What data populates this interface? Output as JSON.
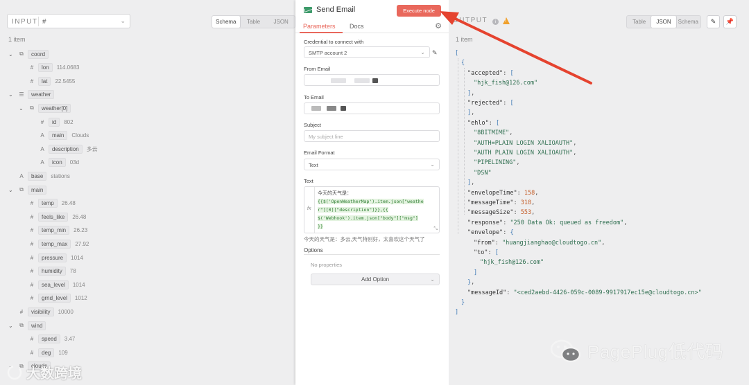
{
  "input_panel": {
    "label": "INPUT",
    "selected": "#",
    "view_tabs": [
      "Schema",
      "Table",
      "JSON"
    ],
    "active_view": "Schema",
    "item_count": "1 item",
    "tree": [
      {
        "key": "coord",
        "type": "object",
        "depth": 0,
        "expanded": true
      },
      {
        "key": "lon",
        "type": "number",
        "value": "114.0683",
        "depth": 1
      },
      {
        "key": "lat",
        "type": "number",
        "value": "22.5455",
        "depth": 1
      },
      {
        "key": "weather",
        "type": "array",
        "depth": 0,
        "expanded": true
      },
      {
        "key": "weather[0]",
        "type": "object",
        "depth": 1,
        "expanded": true
      },
      {
        "key": "id",
        "type": "number",
        "value": "802",
        "depth": 2
      },
      {
        "key": "main",
        "type": "string",
        "value": "Clouds",
        "depth": 2
      },
      {
        "key": "description",
        "type": "string",
        "value": "多云",
        "depth": 2
      },
      {
        "key": "icon",
        "type": "string",
        "value": "03d",
        "depth": 2
      },
      {
        "key": "base",
        "type": "string",
        "value": "stations",
        "depth": 0
      },
      {
        "key": "main",
        "type": "object",
        "depth": 0,
        "expanded": true
      },
      {
        "key": "temp",
        "type": "number",
        "value": "26.48",
        "depth": 1
      },
      {
        "key": "feels_like",
        "type": "number",
        "value": "26.48",
        "depth": 1
      },
      {
        "key": "temp_min",
        "type": "number",
        "value": "26.23",
        "depth": 1
      },
      {
        "key": "temp_max",
        "type": "number",
        "value": "27.92",
        "depth": 1
      },
      {
        "key": "pressure",
        "type": "number",
        "value": "1014",
        "depth": 1
      },
      {
        "key": "humidity",
        "type": "number",
        "value": "78",
        "depth": 1
      },
      {
        "key": "sea_level",
        "type": "number",
        "value": "1014",
        "depth": 1
      },
      {
        "key": "grnd_level",
        "type": "number",
        "value": "1012",
        "depth": 1
      },
      {
        "key": "visibility",
        "type": "number",
        "value": "10000",
        "depth": 0
      },
      {
        "key": "wind",
        "type": "object",
        "depth": 0,
        "expanded": true
      },
      {
        "key": "speed",
        "type": "number",
        "value": "3.47",
        "depth": 1
      },
      {
        "key": "deg",
        "type": "number",
        "value": "109",
        "depth": 1
      },
      {
        "key": "clouds",
        "type": "object",
        "depth": 0,
        "expanded": true
      }
    ]
  },
  "node": {
    "title": "Send Email",
    "execute_label": "Execute node",
    "tabs": [
      "Parameters",
      "Docs"
    ],
    "active_tab": "Parameters",
    "credential_label": "Credential to connect with",
    "credential_value": "SMTP account 2",
    "from_label": "From Email",
    "to_label": "To Email",
    "subject_label": "Subject",
    "subject_placeholder": "My subject line",
    "format_label": "Email Format",
    "format_value": "Text",
    "text_label": "Text",
    "text_lines": [
      "今天的天气是：",
      "{{$('OpenWeatherMap').item.json[\"weathe",
      "r\"][0][\"description\"]}},{{",
      "$('Webhook').item.json[\"body\"][\"msg\"]",
      "}}"
    ],
    "text_result": "今天的天气是：多云,天气特别好，太喜欢这个天气了",
    "options_label": "Options",
    "no_properties": "No properties",
    "add_option": "Add Option"
  },
  "output_panel": {
    "label": "OUTPUT",
    "view_tabs": [
      "Table",
      "JSON",
      "Schema"
    ],
    "active_view": "JSON",
    "item_count": "1 item",
    "json_lines": [
      {
        "indent": 0,
        "parts": [
          [
            "jbr",
            "["
          ]
        ]
      },
      {
        "indent": 1,
        "parts": [
          [
            "jbr",
            "{"
          ]
        ]
      },
      {
        "indent": 2,
        "parts": [
          [
            "jk",
            "\"accepted\""
          ],
          [
            "jp",
            ": "
          ],
          [
            "jbr",
            "["
          ]
        ]
      },
      {
        "indent": 3,
        "parts": [
          [
            "js",
            "\"hjk_fish@126.com\""
          ]
        ]
      },
      {
        "indent": 2,
        "parts": [
          [
            "jbr",
            "]"
          ],
          [
            "jp",
            ","
          ]
        ]
      },
      {
        "indent": 2,
        "parts": [
          [
            "jk",
            "\"rejected\""
          ],
          [
            "jp",
            ": "
          ],
          [
            "jbr",
            "["
          ]
        ]
      },
      {
        "indent": 2,
        "parts": [
          [
            "jbr",
            "]"
          ],
          [
            "jp",
            ","
          ]
        ]
      },
      {
        "indent": 2,
        "parts": [
          [
            "jk",
            "\"ehlo\""
          ],
          [
            "jp",
            ": "
          ],
          [
            "jbr",
            "["
          ]
        ]
      },
      {
        "indent": 3,
        "parts": [
          [
            "js",
            "\"8BITMIME\""
          ],
          [
            "jp",
            ","
          ]
        ]
      },
      {
        "indent": 3,
        "parts": [
          [
            "js",
            "\"AUTH=PLAIN LOGIN XALIOAUTH\""
          ],
          [
            "jp",
            ","
          ]
        ]
      },
      {
        "indent": 3,
        "parts": [
          [
            "js",
            "\"AUTH PLAIN LOGIN XALIOAUTH\""
          ],
          [
            "jp",
            ","
          ]
        ]
      },
      {
        "indent": 3,
        "parts": [
          [
            "js",
            "\"PIPELINING\""
          ],
          [
            "jp",
            ","
          ]
        ]
      },
      {
        "indent": 3,
        "parts": [
          [
            "js",
            "\"DSN\""
          ]
        ]
      },
      {
        "indent": 2,
        "parts": [
          [
            "jbr",
            "]"
          ],
          [
            "jp",
            ","
          ]
        ]
      },
      {
        "indent": 2,
        "parts": [
          [
            "jk",
            "\"envelopeTime\""
          ],
          [
            "jp",
            ": "
          ],
          [
            "jn",
            "158"
          ],
          [
            "jp",
            ","
          ]
        ]
      },
      {
        "indent": 2,
        "parts": [
          [
            "jk",
            "\"messageTime\""
          ],
          [
            "jp",
            ": "
          ],
          [
            "jn",
            "318"
          ],
          [
            "jp",
            ","
          ]
        ]
      },
      {
        "indent": 2,
        "parts": [
          [
            "jk",
            "\"messageSize\""
          ],
          [
            "jp",
            ": "
          ],
          [
            "jn",
            "553"
          ],
          [
            "jp",
            ","
          ]
        ]
      },
      {
        "indent": 2,
        "parts": [
          [
            "jk",
            "\"response\""
          ],
          [
            "jp",
            ": "
          ],
          [
            "js",
            "\"250 Data Ok: queued as freedom\""
          ],
          [
            "jp",
            ","
          ]
        ]
      },
      {
        "indent": 2,
        "parts": [
          [
            "jk",
            "\"envelope\""
          ],
          [
            "jp",
            ": "
          ],
          [
            "jbr",
            "{"
          ]
        ]
      },
      {
        "indent": 3,
        "parts": [
          [
            "jk",
            "\"from\""
          ],
          [
            "jp",
            ": "
          ],
          [
            "js",
            "\"huangjianghao@cloudtogo.cn\""
          ],
          [
            "jp",
            ","
          ]
        ]
      },
      {
        "indent": 3,
        "parts": [
          [
            "jk",
            "\"to\""
          ],
          [
            "jp",
            ": "
          ],
          [
            "jbr",
            "["
          ]
        ]
      },
      {
        "indent": 4,
        "parts": [
          [
            "js",
            "\"hjk_fish@126.com\""
          ]
        ]
      },
      {
        "indent": 3,
        "parts": [
          [
            "jbr",
            "]"
          ]
        ]
      },
      {
        "indent": 2,
        "parts": [
          [
            "jbr",
            "}"
          ],
          [
            "jp",
            ","
          ]
        ]
      },
      {
        "indent": 2,
        "parts": [
          [
            "jk",
            "\"messageId\""
          ],
          [
            "jp",
            ": "
          ],
          [
            "js",
            "\"<ced2aebd-4426-059c-0089-9917917ec15e@cloudtogo.cn>\""
          ]
        ]
      },
      {
        "indent": 1,
        "parts": [
          [
            "jbr",
            "}"
          ]
        ]
      },
      {
        "indent": 0,
        "parts": [
          [
            "jbr",
            "]"
          ]
        ]
      }
    ]
  },
  "watermarks": {
    "right": "PagePlug低代码",
    "left": "大数跨境"
  },
  "colors": {
    "accent": "#e9685c",
    "annotation_arrow": "#e5432f",
    "node_icon": "#3d9a6a"
  }
}
